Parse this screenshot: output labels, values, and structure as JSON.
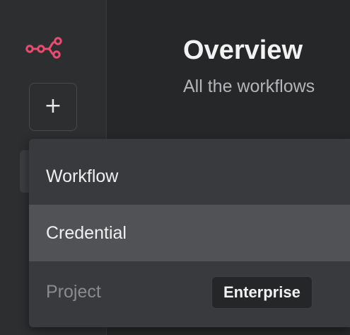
{
  "header": {
    "title": "Overview",
    "subtitle": "All the workflows"
  },
  "sidebar": {
    "logo_icon": "n8n-logo-icon",
    "new_button_icon": "plus-icon",
    "new_button_glyph": "+"
  },
  "dropdown": {
    "items": [
      {
        "label": "Workflow",
        "state": "default"
      },
      {
        "label": "Credential",
        "state": "hovered"
      },
      {
        "label": "Project",
        "state": "disabled",
        "badge": "Enterprise"
      }
    ]
  },
  "colors": {
    "brand": "#ea4b71",
    "sidebar_bg": "#2d2e30",
    "main_bg": "#262728",
    "menu_bg": "#383a3d",
    "menu_hover_bg": "#505255"
  }
}
